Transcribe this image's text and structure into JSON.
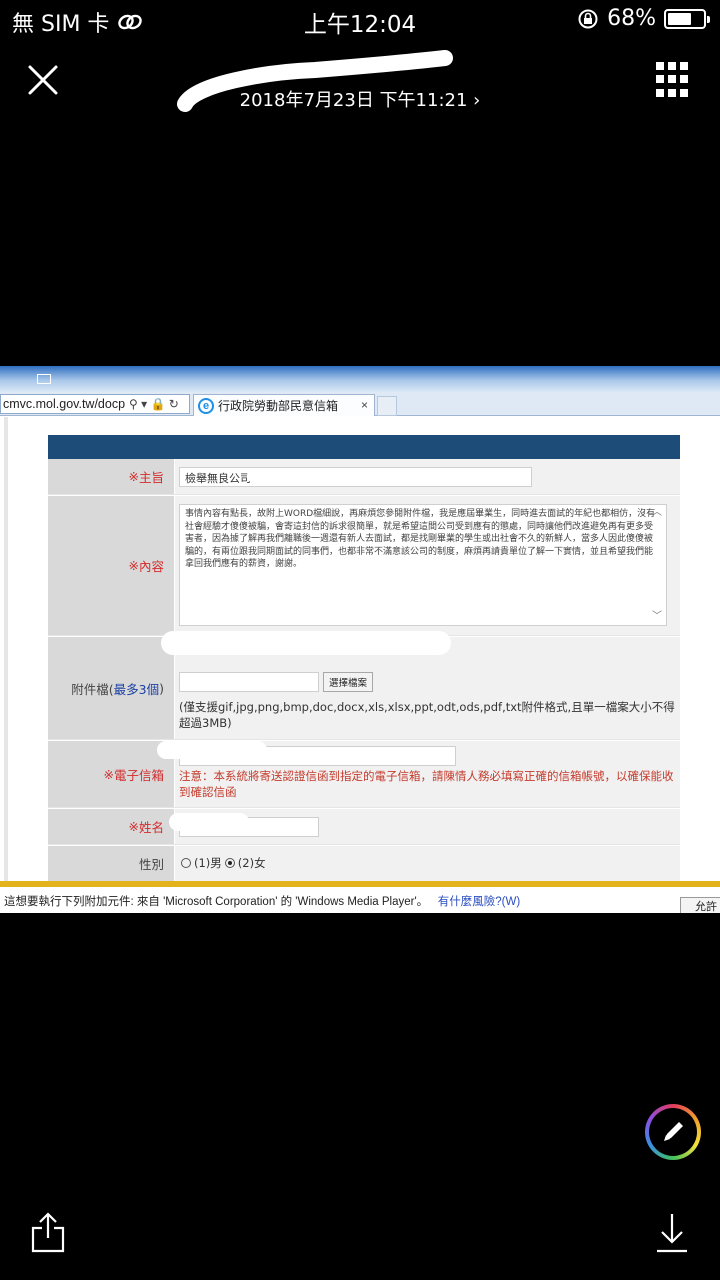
{
  "status_bar": {
    "carrier": "無 SIM 卡",
    "time": "上午12:04",
    "battery_percent": "68%",
    "battery_level": 0.68,
    "icons": [
      "wifi-link-icon",
      "orientation-lock-icon",
      "battery-icon"
    ]
  },
  "viewer": {
    "photo_date": "2018年7月23日 下午11:21 ›",
    "close_icon": "close-icon",
    "grid_icon": "grid-icon"
  },
  "browser": {
    "address": "cmvc.mol.gov.tw/docp",
    "tab_title": "行政院勞動部民意信箱",
    "tab_close": "×"
  },
  "form": {
    "subject": {
      "label": "主旨",
      "value": "檢舉無良公司"
    },
    "content": {
      "label": "內容",
      "text": "事情內容有點長，故附上WORD檔細說，再麻煩您參閱附件檔，我是應屆畢業生，同時進去面試的年紀也都相仿，沒有社會經驗才傻傻被騙，會寄這封信的訴求很簡單，就是希望這間公司受到應有的懲處，同時讓他們改進避免再有更多受害者，因為據了解再我們離職後一週還有新人去面試，都是找剛畢業的學生或出社會不久的新鮮人，當多人因此傻傻被騙的，有兩位跟我同期面試的同事們，也都非常不滿意該公司的制度，麻煩再請貴單位了解一下實情，並且希望我們能拿回我們應有的薪資，謝謝。"
    },
    "attachment": {
      "label_prefix": "附件檔(",
      "label_highlight": "最多3個",
      "label_suffix": ")",
      "button": "選擇檔案",
      "hint": "(僅支援gif,jpg,png,bmp,doc,docx,xls,xlsx,ppt,odt,ods,pdf,txt附件格式,且單一檔案大小不得超過3MB)"
    },
    "email": {
      "label": "電子信箱",
      "warning": "注意：本系統將寄送認證信函到指定的電子信箱，請陳情人務必填寫正確的信箱帳號，以確保能收到確認信函"
    },
    "name": {
      "label": "姓名"
    },
    "gender": {
      "label": "性別",
      "options": [
        "(1)男",
        "(2)女"
      ],
      "selected": 1
    },
    "required_mark": "※"
  },
  "info_bar": {
    "text": "這想要執行下列附加元件: 來自 'Microsoft Corporation' 的 'Windows Media Player'。",
    "link": "有什麼風險?(W)",
    "button": "允許"
  },
  "toolbar": {
    "markup_icon": "markup-pen-icon",
    "share_icon": "share-icon",
    "save_icon": "download-icon"
  }
}
